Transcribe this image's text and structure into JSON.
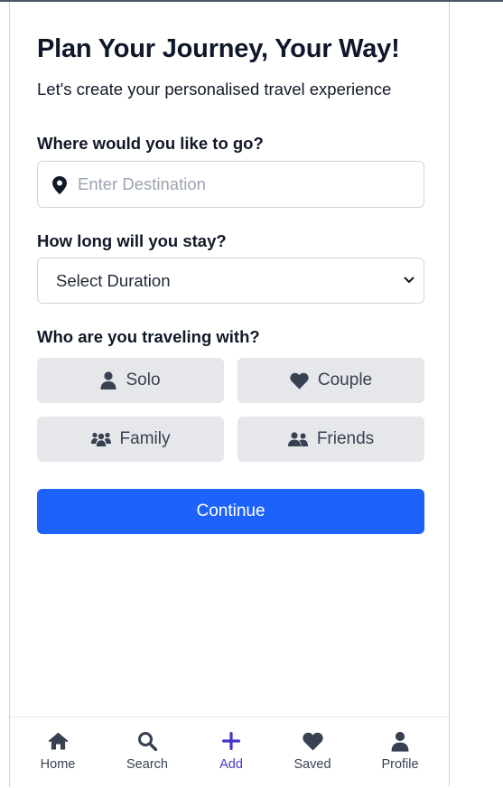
{
  "page": {
    "title": "Plan Your Journey, Your Way!",
    "subtitle": "Let's create your personalised travel experience"
  },
  "destination": {
    "label": "Where would you like to go?",
    "placeholder": "Enter Destination",
    "icon": "map-pin-icon"
  },
  "duration": {
    "label": "How long will you stay?",
    "selected": "Select Duration"
  },
  "companions": {
    "label": "Who are you traveling with?",
    "options": [
      {
        "label": "Solo",
        "icon": "user-icon"
      },
      {
        "label": "Couple",
        "icon": "heart-icon"
      },
      {
        "label": "Family",
        "icon": "family-icon"
      },
      {
        "label": "Friends",
        "icon": "friends-icon"
      }
    ]
  },
  "continue_label": "Continue",
  "nav": {
    "items": [
      {
        "label": "Home",
        "icon": "home-icon"
      },
      {
        "label": "Search",
        "icon": "search-icon"
      },
      {
        "label": "Add",
        "icon": "plus-icon",
        "active": true
      },
      {
        "label": "Saved",
        "icon": "heart-icon"
      },
      {
        "label": "Profile",
        "icon": "user-icon"
      }
    ]
  },
  "colors": {
    "primary": "#1d63fb",
    "active_nav": "#4338ca",
    "option_bg": "#e5e7eb",
    "icon_dark": "#374151"
  }
}
